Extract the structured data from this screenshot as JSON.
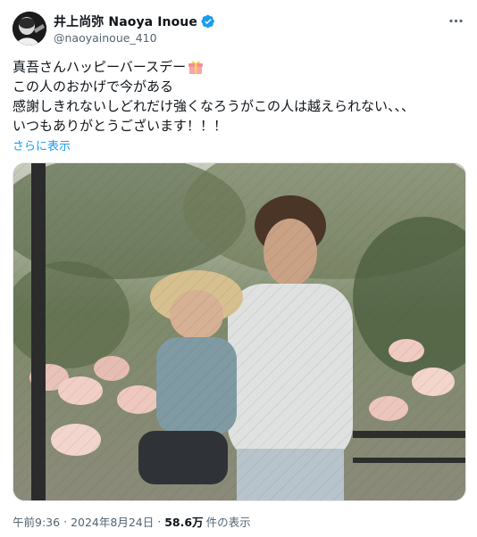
{
  "author": {
    "display_name": "井上尚弥 Naoya Inoue",
    "handle": "@naoyainoue_410",
    "verified_icon": "verified-badge-icon",
    "accent_color": "#1d9bf0"
  },
  "tweet": {
    "lines": [
      "真吾さんハッピーバースデー",
      "この人のおかげで今がある",
      "感謝しきれないしどれだけ強くなろうがこの人は越えられない、、、",
      "いつもありがとうございます！！！"
    ],
    "first_line_icon": "gift-icon",
    "show_more": "さらに表示"
  },
  "media": {
    "photo_icon": "photo-image"
  },
  "meta": {
    "time": "午前9:36",
    "separator": "·",
    "date": "2024年8月24日",
    "views_count": "58.6万",
    "views_label": "件の表示"
  },
  "colors": {
    "text_primary": "#0f1419",
    "text_secondary": "#536471",
    "link": "#1d9bf0"
  }
}
